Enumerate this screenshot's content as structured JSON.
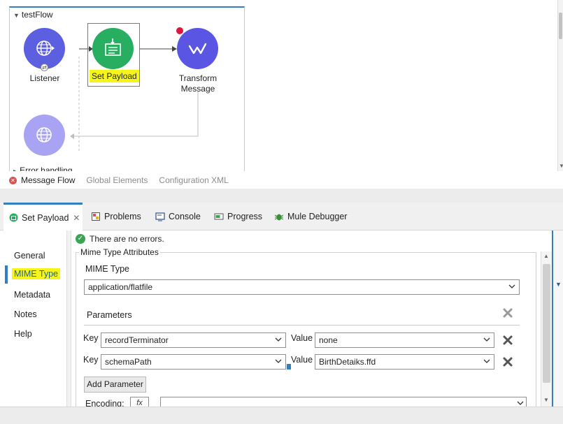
{
  "flow": {
    "title": "testFlow",
    "nodes": {
      "listener": "Listener",
      "set_payload": "Set Payload",
      "transform_line1": "Transform",
      "transform_line2": "Message"
    },
    "error_handling": "Error handling"
  },
  "editor_tabs": {
    "message_flow": "Message Flow",
    "global_elements": "Global Elements",
    "configuration_xml": "Configuration XML"
  },
  "panel_tabs": {
    "set_payload": "Set Payload",
    "problems": "Problems",
    "console": "Console",
    "progress": "Progress",
    "mule_debugger": "Mule Debugger"
  },
  "side_nav": {
    "general": "General",
    "mime_type": "MIME Type",
    "metadata": "Metadata",
    "notes": "Notes",
    "help": "Help"
  },
  "status": "There are no errors.",
  "mime": {
    "group_title": "Mime Type Attributes",
    "mime_type_label": "MIME Type",
    "mime_type_value": "application/flatfile",
    "parameters_label": "Parameters",
    "key_label": "Key",
    "value_label": "Value",
    "params": [
      {
        "key": "recordTerminator",
        "value": "none"
      },
      {
        "key": "schemaPath",
        "value": "BirthDetaiks.ffd"
      }
    ],
    "add_parameter": "Add Parameter",
    "encoding_label": "Encoding:",
    "fx": "fx"
  },
  "colors": {
    "accent_blue": "#2f7fc1",
    "listener_purple": "#5b5fe0",
    "set_payload_green": "#27ae60",
    "transform_purple": "#5b55e4",
    "highlight_yellow": "#f5f51b"
  }
}
